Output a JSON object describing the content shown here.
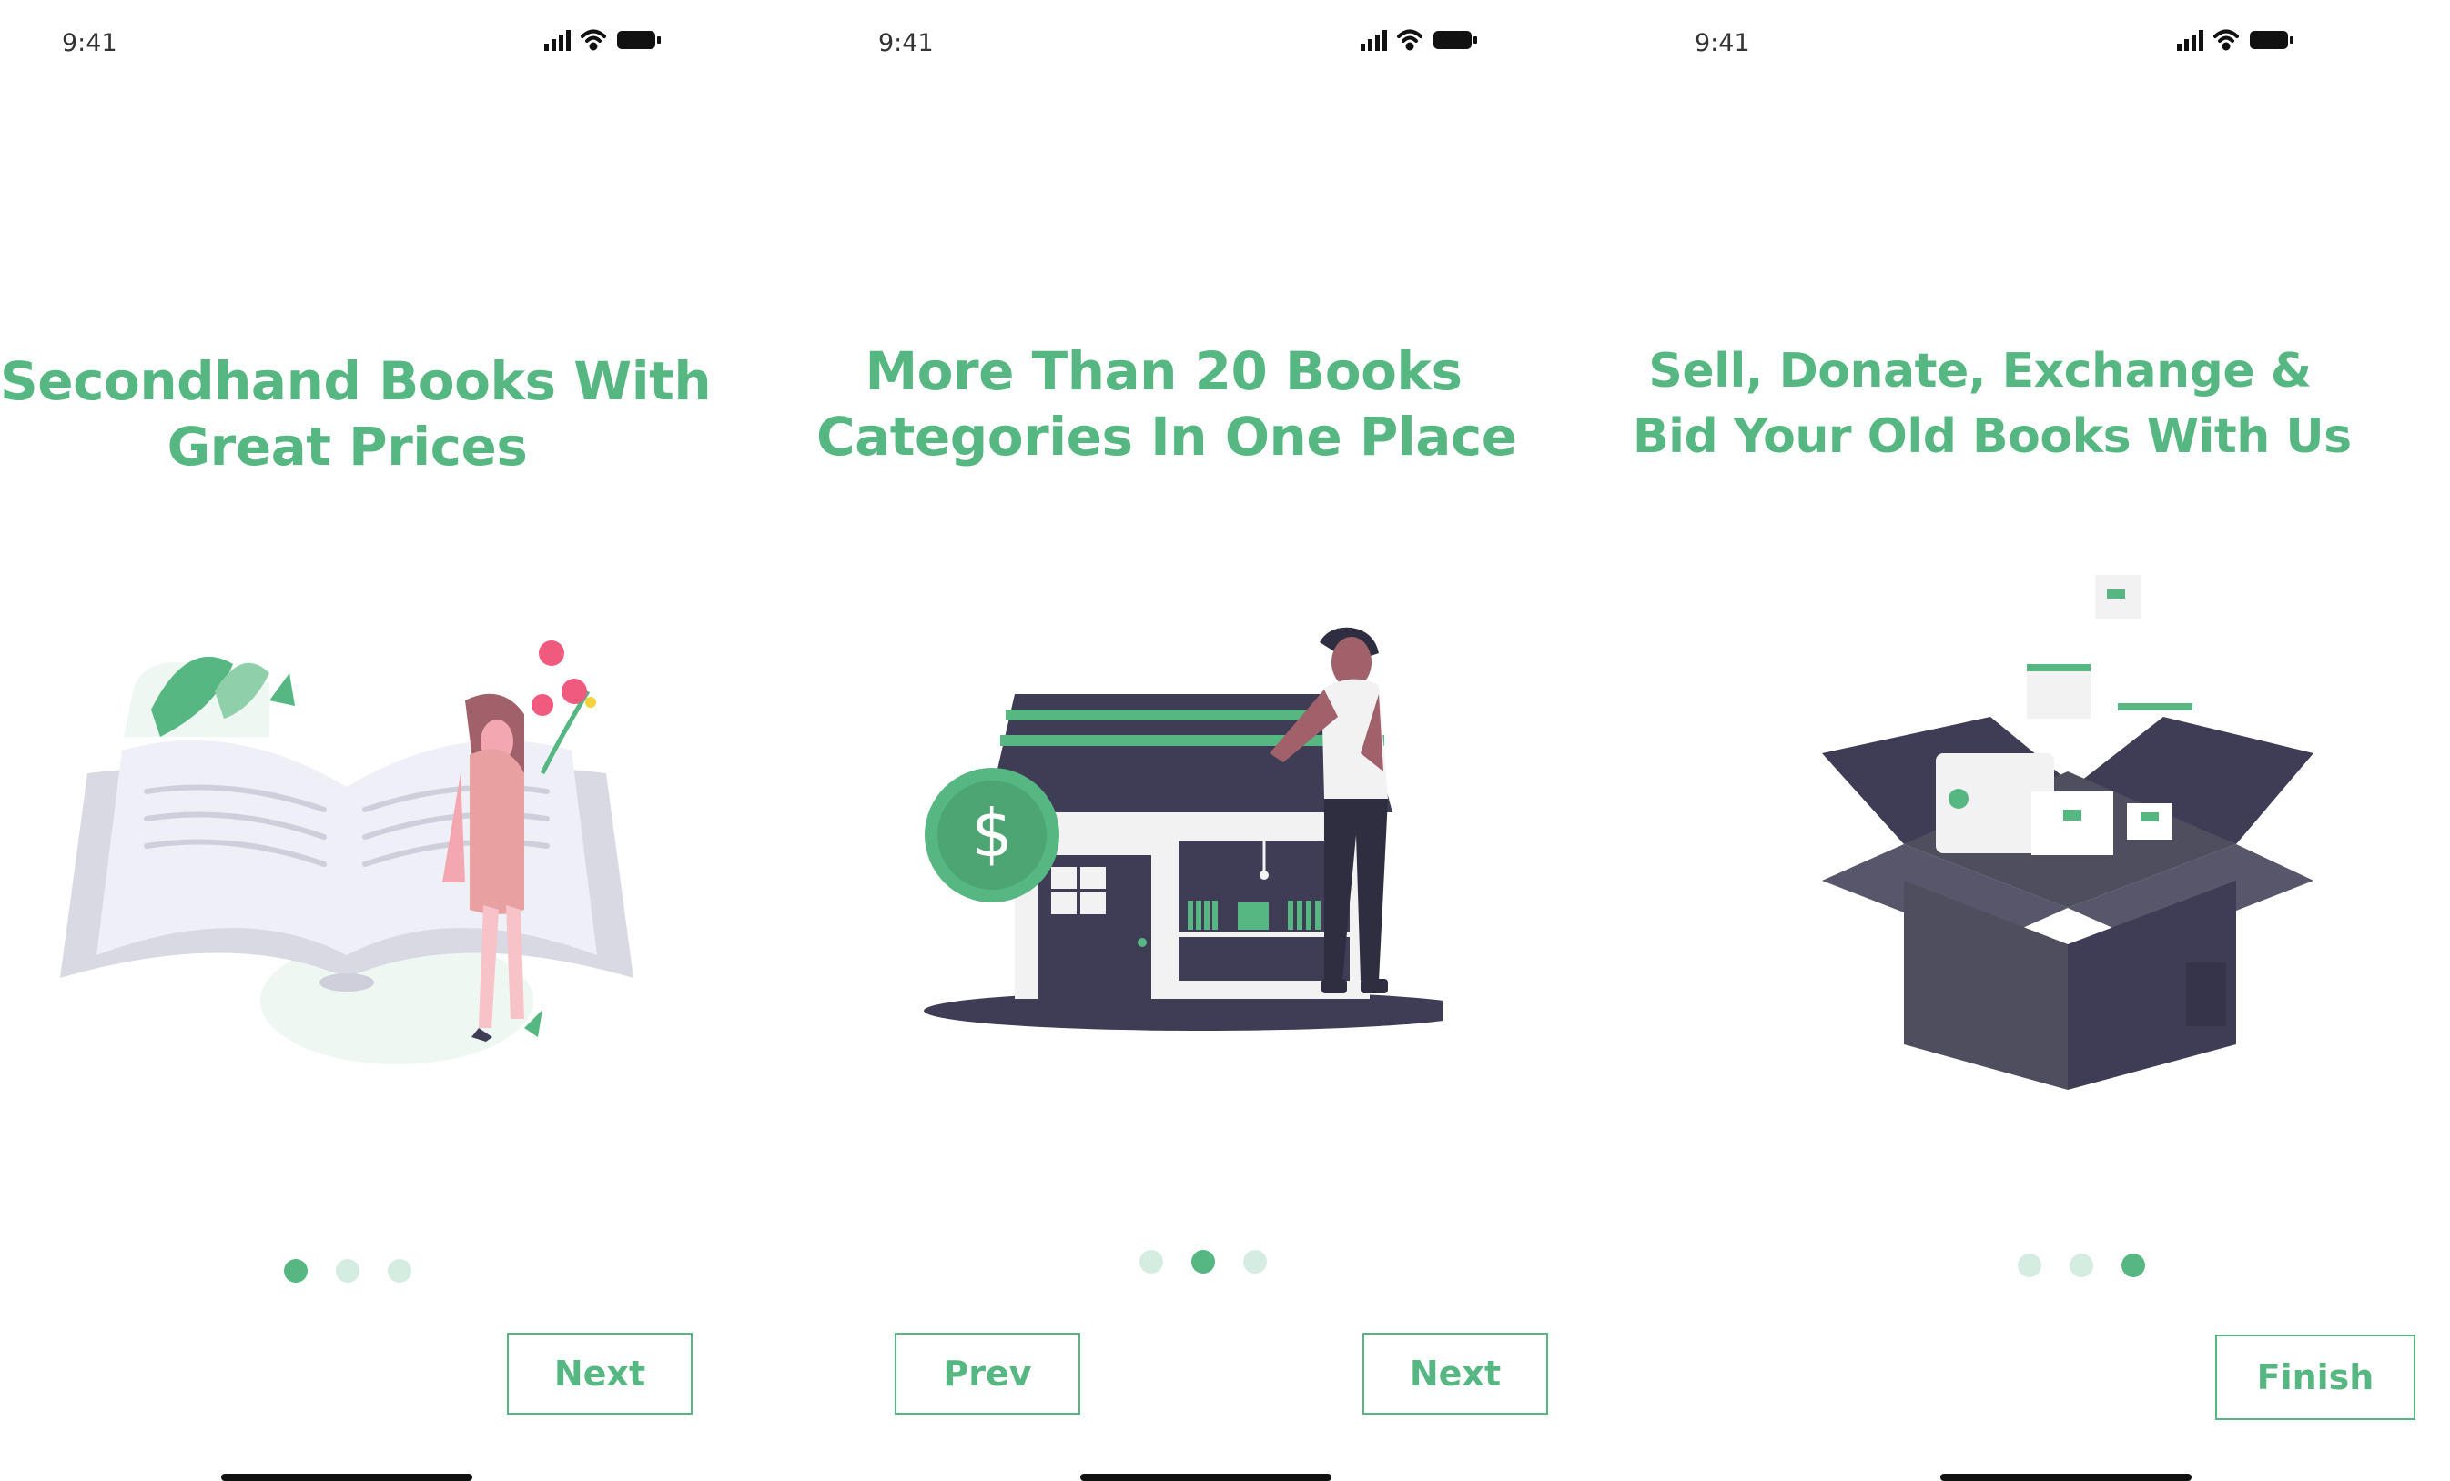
{
  "status_bar": {
    "time": "9:41"
  },
  "screens": [
    {
      "title_lines": [
        "Secondhand Books With",
        "Great Prices"
      ],
      "pagination": {
        "current": 1,
        "total": 3
      },
      "buttons": {
        "next": "Next"
      }
    },
    {
      "title_lines": [
        "More Than 20 Books",
        "Categories In One Place"
      ],
      "pagination": {
        "current": 2,
        "total": 3
      },
      "buttons": {
        "prev": "Prev",
        "next": "Next"
      }
    },
    {
      "title_lines": [
        "Sell, Donate, Exchange &",
        "Bid Your Old Books With Us"
      ],
      "pagination": {
        "current": 3,
        "total": 3
      },
      "buttons": {
        "finish": "Finish"
      }
    }
  ],
  "colors": {
    "accent": "#57b782",
    "dot_inactive": "#d5ede0",
    "dark": "#3f3d56"
  },
  "icons": [
    "signal-icon",
    "wifi-icon",
    "battery-icon",
    "dollar-icon"
  ]
}
